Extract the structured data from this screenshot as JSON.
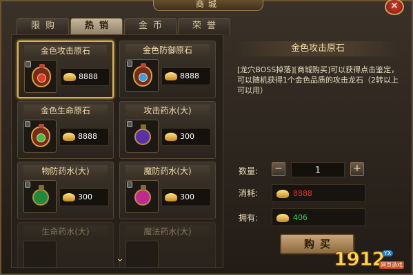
{
  "window": {
    "title": "商城",
    "close_icon": "close-icon"
  },
  "tabs": [
    {
      "label": "限购",
      "active": false
    },
    {
      "label": "热销",
      "active": true
    },
    {
      "label": "金币",
      "active": false
    },
    {
      "label": "荣誉",
      "active": false
    }
  ],
  "items": [
    {
      "name": "金色攻击原石",
      "price": "8888",
      "icon": "red-gem-bag-icon",
      "selected": true
    },
    {
      "name": "金色防御原石",
      "price": "8888",
      "icon": "blue-gem-bag-icon",
      "selected": false
    },
    {
      "name": "金色生命原石",
      "price": "8888",
      "icon": "green-gem-bag-icon",
      "selected": false
    },
    {
      "name": "攻击药水(大)",
      "price": "300",
      "icon": "purple-potion-icon",
      "selected": false
    },
    {
      "name": "物防药水(大)",
      "price": "300",
      "icon": "green-potion-icon",
      "selected": false
    },
    {
      "name": "魔防药水(大)",
      "price": "300",
      "icon": "pink-potion-icon",
      "selected": false
    },
    {
      "name": "生命药水(大)",
      "price": "",
      "icon": "potion-icon",
      "selected": false
    },
    {
      "name": "魔法药水(大)",
      "price": "",
      "icon": "potion-icon",
      "selected": false
    }
  ],
  "colors": {
    "red_gem": "#d8402a",
    "blue_gem": "#3aa0e0",
    "green_gem": "#3fbf4a",
    "purple_potion": "#5a2fa8",
    "green_potion": "#1f8a3a",
    "pink_potion": "#c02a8e",
    "cost_red": "#e0342a",
    "own_green": "#3fd45a"
  },
  "detail": {
    "title": "金色攻击原石",
    "description": "[龙穴BOSS掉落][商城购买]可以获得点击鉴定，可以随机获得1个金色品质的攻击龙石（2转以上可以用）",
    "quantity_label": "数量:",
    "quantity_value": "1",
    "minus": "−",
    "plus": "+",
    "cost_label": "消耗:",
    "cost_value": "8888",
    "own_label": "拥有:",
    "own_value": "406",
    "buy_label": "购买"
  },
  "watermark": {
    "number": "1912",
    "badge": "YX",
    "sub": "网页游戏"
  }
}
